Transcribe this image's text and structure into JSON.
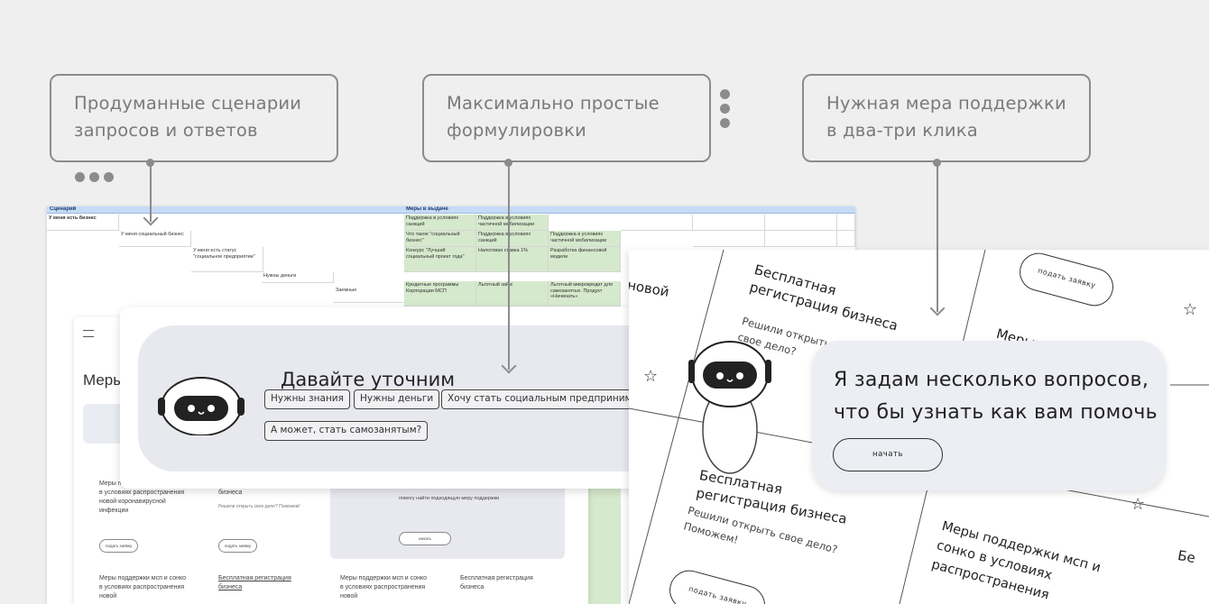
{
  "callouts": [
    {
      "line1": "Продуманные сценарии",
      "line2": "запросов и ответов"
    },
    {
      "line1": "Максимально простые",
      "line2": "формулировки"
    },
    {
      "line1": "Нужная мера поддержки",
      "line2": "в два-три клика"
    }
  ],
  "sheet": {
    "header_left": "Сценарий",
    "header_right": "Меры в выдаче",
    "rows": [
      "У меня есть бизнес",
      "У меня социальный бизнес",
      "У меня есть статус \"социальное предприятие\"",
      "Нужны деньги",
      "Заемные"
    ],
    "measures": [
      "Поддержка в условиях санкций",
      "Поддержка в условиях частичной мобилизации",
      "Что такое \"социальный бизнес\"",
      "Поддержка в условиях санкций",
      "Поддержка в условиях частичной мобилизации",
      "Конкурс \"Лучший социальный проект года\"",
      "Налоговая ставка 1%",
      "Разработка финансовой модели",
      "Кредитные программы Корпорации МСП",
      "Льготный займ",
      "Льготный микрокредит для самозанятых. Продукт «Начинать»"
    ]
  },
  "web": {
    "title": "Меры",
    "card1": "Меры поддержки мсп и сонко в условиях распространения новой коронавирусной инфекции",
    "card2": "Бесплатная регистрация бизнеса",
    "card2_sub": "Решили открыть свое дело? Поможем!",
    "help": "помогу найти подходящую меру поддержки",
    "apply": "подать заявку",
    "start": "начать",
    "bottom1": "Меры поддержки мсп и сонко в условиях распространения новой",
    "bottom2": "Бесплатная регистрация бизнеса"
  },
  "dialog": {
    "question": "Давайте уточним",
    "chips": [
      "Нужны знания",
      "Нужны деньги",
      "Хочу стать социальным предпринимател",
      "А может, стать самозанятым?"
    ]
  },
  "right_panel": {
    "reg_title": "Бесплатная регистрация бизнеса",
    "reg_sub": "Решили открыть свое дело? Поможем!",
    "apply": "подать заявку",
    "measures": "Меры поддержки мсп и сонко в условиях распространения",
    "fragment_new": "новой",
    "bubble_line1": "Я задам несколько вопросов,",
    "bubble_line2": "что бы узнать как вам помочь",
    "start": "начать"
  }
}
